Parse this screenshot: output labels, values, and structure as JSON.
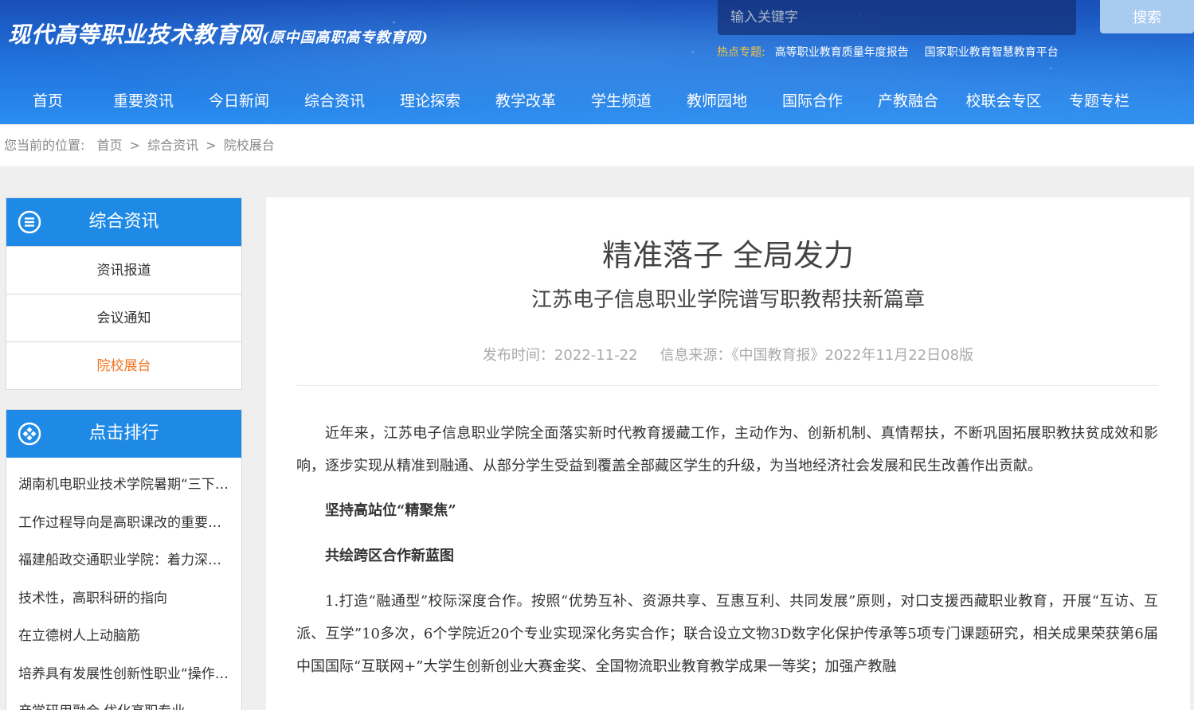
{
  "header": {
    "logo_main": "现代高等职业技术教育网",
    "logo_sub": "(原中国高职高专教育网)",
    "search_placeholder": "输入关键字",
    "search_button": "搜索",
    "hot_label": "热点专题:",
    "hot_links": [
      "高等职业教育质量年度报告",
      "国家职业教育智慧教育平台"
    ]
  },
  "nav": [
    "首页",
    "重要资讯",
    "今日新闻",
    "综合资讯",
    "理论探索",
    "教学改革",
    "学生频道",
    "教师园地",
    "国际合作",
    "产教融合",
    "校联会专区",
    "专题专栏"
  ],
  "breadcrumb": {
    "prefix": "您当前的位置:",
    "items": [
      "首页",
      "综合资讯",
      "院校展台"
    ],
    "separator": ">"
  },
  "sidebar": {
    "category_title": "综合资讯",
    "category_items": [
      "资讯报道",
      "会议通知",
      "院校展台"
    ],
    "active_index": 2,
    "rank_title": "点击排行",
    "rank_items": [
      "湖南机电职业技术学院暑期“三下乡”",
      "工作过程导向是高职课改的重要方向",
      "福建船政交通职业学院：着力深化改革",
      "技术性，高职科研的指向",
      "在立德树人上动脑筋",
      "培养具有发展性创新性职业“操作者”",
      "产学研用融合 优化高职专业"
    ]
  },
  "article": {
    "title": "精准落子 全局发力",
    "subtitle": "江苏电子信息职业学院谱写职教帮扶新篇章",
    "publish_label": "发布时间：2022-11-22",
    "source_label": "信息来源：《中国教育报》2022年11月22日08版",
    "paragraphs": [
      "近年来，江苏电子信息职业学院全面落实新时代教育援藏工作，主动作为、创新机制、真情帮扶，不断巩固拓展职教扶贫成效和影响，逐步实现从精准到融通、从部分学生受益到覆盖全部藏区学生的升级，为当地经济社会发展和民生改善作出贡献。",
      "坚持高站位“精聚焦”",
      "共绘跨区合作新蓝图",
      "1.打造“融通型”校际深度合作。按照“优势互补、资源共享、互惠互利、共同发展”原则，对口支援西藏职业教育，开展“互访、互派、互学”10多次，6个学院近20个专业实现深化务实合作；联合设立文物3D数字化保护传承等5项专门课题研究，相关成果荣获第6届中国国际“互联网+”大学生创新创业大赛金奖、全国物流职业教育教学成果一等奖；加强产教融"
    ]
  }
}
